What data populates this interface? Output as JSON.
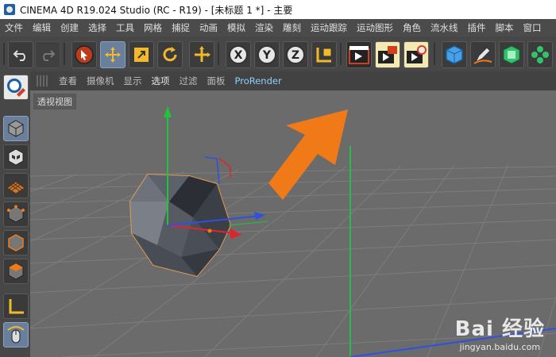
{
  "window": {
    "title": "CINEMA 4D R19.024 Studio (RC - R19) - [未标题 1 *] - 主要"
  },
  "menubar": {
    "items": [
      "文件",
      "编辑",
      "创建",
      "选择",
      "工具",
      "网格",
      "捕捉",
      "动画",
      "模拟",
      "渲染",
      "雕刻",
      "运动跟踪",
      "运动图形",
      "角色",
      "流水线",
      "插件",
      "脚本",
      "窗口"
    ]
  },
  "toolbar": {
    "tools": [
      "undo-icon",
      "redo-icon",
      "live-select-icon",
      "move-icon",
      "scale-icon",
      "rotate-icon",
      "recent-tool-icon",
      "x-axis-icon",
      "y-axis-icon",
      "z-axis-icon",
      "coordinate-system-icon",
      "render-view-icon",
      "render-picture-viewer-icon",
      "render-settings-icon",
      "cube-icon",
      "pen-icon",
      "subdivision-icon",
      "array-icon"
    ]
  },
  "viewport_menu": {
    "items": [
      "查看",
      "摄像机",
      "显示",
      "选项",
      "过滤",
      "面板",
      "ProRender"
    ]
  },
  "viewport": {
    "label": "透视视图"
  },
  "left_tools": [
    "make-editable-icon",
    "model-mode-icon",
    "texture-mode-icon",
    "workplane-icon",
    "points-mode-icon",
    "edges-mode-icon",
    "polygons-mode-icon",
    "axis-mode-icon",
    "tweak-mode-icon"
  ],
  "watermark": {
    "line1": "Bai 经验",
    "line2": "jingyan.baidu.com"
  },
  "colors": {
    "accent": "#f07a17",
    "selection": "#6a7f9b",
    "axis_x": "#e0242a",
    "axis_y": "#22c33c",
    "axis_z": "#2a4fe0"
  }
}
